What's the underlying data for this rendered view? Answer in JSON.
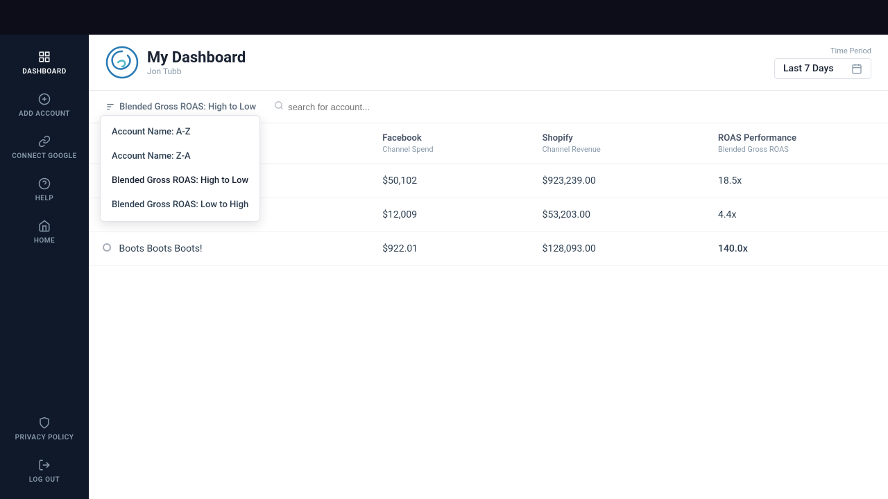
{
  "topbar": {},
  "sidebar": {
    "items": [
      {
        "id": "dashboard",
        "label": "DASHBOARD",
        "icon": "grid",
        "active": true
      },
      {
        "id": "add-account",
        "label": "ADD ACCOUNT",
        "icon": "plus-circle",
        "active": false
      },
      {
        "id": "connect-google",
        "label": "CONNECT GOOGLE",
        "icon": "link",
        "active": false
      },
      {
        "id": "help",
        "label": "HELP",
        "icon": "question-circle",
        "active": false
      },
      {
        "id": "home",
        "label": "HOME",
        "icon": "home",
        "active": false
      }
    ],
    "bottom_items": [
      {
        "id": "privacy-policy",
        "label": "PRIVACY POLICY",
        "icon": "shield"
      },
      {
        "id": "log-out",
        "label": "LOG OUT",
        "icon": "log-out"
      }
    ]
  },
  "header": {
    "title": "My Dashboard",
    "user": "Jon Tubb",
    "time_period_label": "Time Period",
    "time_period_value": "Last 7 Days"
  },
  "filter_bar": {
    "sort_label": "Blended Gross ROAS: High to Low",
    "search_placeholder": "search for account...",
    "dropdown": {
      "visible": true,
      "options": [
        {
          "id": "name-az",
          "label": "Account Name: A-Z"
        },
        {
          "id": "name-za",
          "label": "Account Name: Z-A"
        },
        {
          "id": "roas-high-low",
          "label": "Blended Gross ROAS: High to Low",
          "selected": true
        },
        {
          "id": "roas-low-high",
          "label": "Blended Gross ROAS: Low to High"
        }
      ]
    }
  },
  "table": {
    "columns": [
      {
        "id": "account",
        "main": "",
        "sub": ""
      },
      {
        "id": "facebook",
        "main": "Facebook",
        "sub": "Channel Spend"
      },
      {
        "id": "shopify",
        "main": "Shopify",
        "sub": "Channel Revenue"
      },
      {
        "id": "roas",
        "main": "ROAS Performance",
        "sub": "Blended Gross ROAS"
      }
    ],
    "rows": [
      {
        "account": "",
        "facebook": "$50,102",
        "shopify": "$923,239.00",
        "roas": "18.5x",
        "roas_highlight": false
      },
      {
        "account": "",
        "facebook": "$12,009",
        "shopify": "$53,203.00",
        "roas": "4.4x",
        "roas_highlight": false
      },
      {
        "account": "Boots Boots Boots!",
        "facebook": "$922.01",
        "shopify": "$128,093.00",
        "roas": "140.0x",
        "roas_highlight": true
      }
    ]
  }
}
